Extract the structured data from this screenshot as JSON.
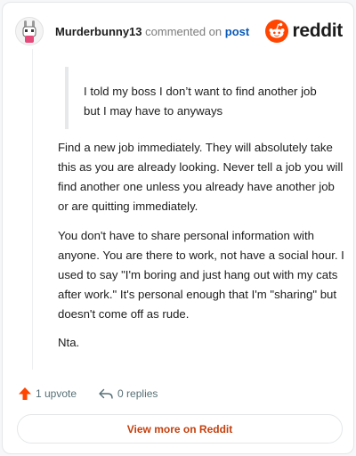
{
  "comment": {
    "author": "Murderbunny13",
    "action_text": "commented on",
    "post_link_text": "post",
    "quote": "I told my boss I don’t want to find another job but I may have to anyways",
    "paragraphs": [
      "Find a new job immediately. They will absolutely take this as you are already looking. Never tell a job you will find another one unless you already have another job or are quitting immediately.",
      "You don't have to share personal information with anyone. You are there to work, not have a social hour. I used to say \"I'm boring and just hang out with my cats after work.\" It's personal enough that I'm \"sharing\" but doesn't come off as rude.",
      "Nta."
    ]
  },
  "brand": {
    "wordmark": "reddit",
    "brand_color": "#ff4500"
  },
  "actions": {
    "upvote_label": "1 upvote",
    "reply_label": "0 replies"
  },
  "footer": {
    "view_more_label": "View more on Reddit"
  },
  "icons": {
    "avatar": "avatar",
    "brand": "reddit-logo-icon",
    "upvote": "upvote-arrow-icon",
    "reply": "reply-icon"
  },
  "colors": {
    "link": "#0a59b8",
    "upvote": "#ff4500",
    "view_more_text": "#c4400e"
  }
}
